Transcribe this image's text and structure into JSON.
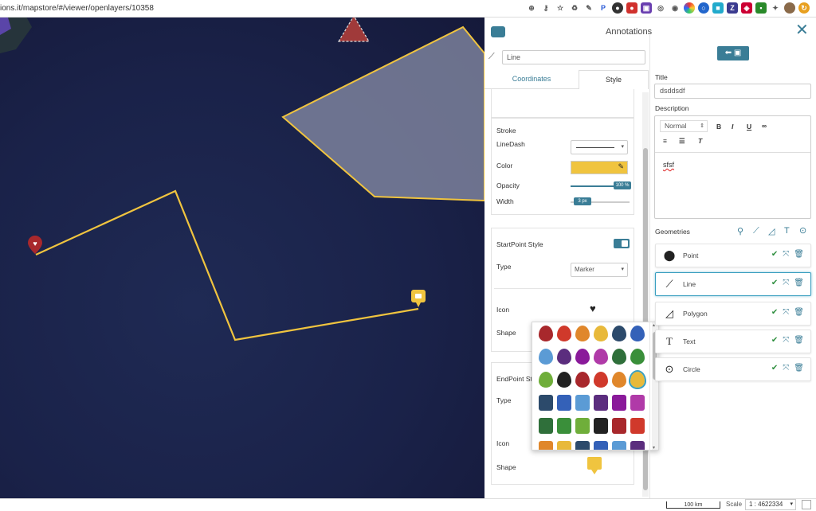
{
  "browser": {
    "url": "ions.it/mapstore/#/viewer/openlayers/10358"
  },
  "map": {
    "line_color": "#f0c43f",
    "polygon_fill": "#8a8fa8",
    "marker_start_color": "#a8282c",
    "marker_end_color": "#f0c43f"
  },
  "panel": {
    "title": "Annotations",
    "geometry_name": "Line",
    "tabs": {
      "coordinates": "Coordinates",
      "style": "Style"
    },
    "stroke": {
      "heading": "Stroke",
      "linedash_label": "LineDash",
      "color_label": "Color",
      "color_value": "#f0c43f",
      "opacity_label": "Opacity",
      "opacity_value": "100 %",
      "width_label": "Width",
      "width_value": "3 px"
    },
    "start_point": {
      "heading": "StartPoint Style",
      "type_label": "Type",
      "type_value": "Marker",
      "icon_label": "Icon",
      "shape_label": "Shape"
    },
    "end_point": {
      "heading": "EndPoint St",
      "type_label": "Type",
      "icon_label": "Icon",
      "shape_label": "Shape"
    },
    "form": {
      "title_label": "Title",
      "title_value": "dsddsdf",
      "description_label": "Description",
      "format_select": "Normal",
      "description_text": "sfsf",
      "geometries_label": "Geometries"
    },
    "geometries": [
      {
        "label": "Point",
        "icon": "marker-icon"
      },
      {
        "label": "Line",
        "icon": "line-icon"
      },
      {
        "label": "Polygon",
        "icon": "polygon-icon"
      },
      {
        "label": "Text",
        "icon": "text-icon"
      },
      {
        "label": "Circle",
        "icon": "circle-icon"
      }
    ]
  },
  "footer": {
    "scale_bar": "100 km",
    "scale_label": "Scale",
    "scale_value": "1 : 4622334"
  }
}
